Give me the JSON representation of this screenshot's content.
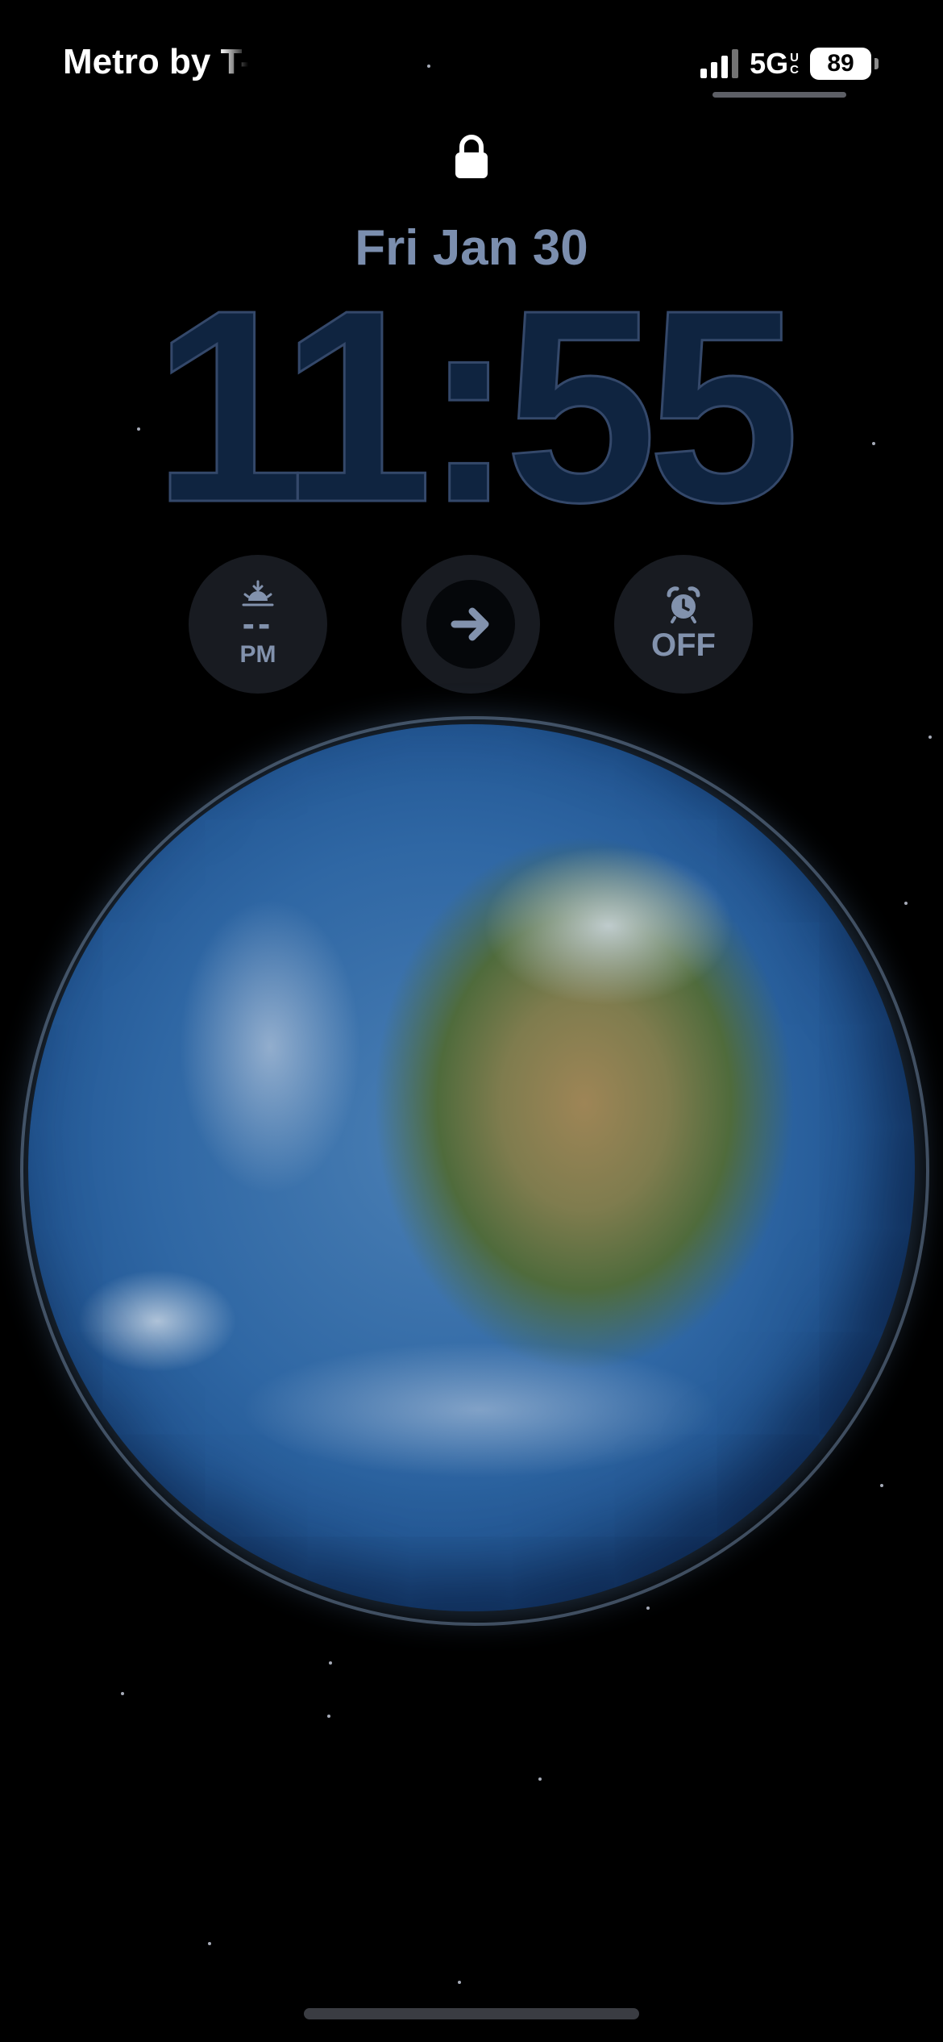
{
  "status_bar": {
    "carrier": "Metro by T-Mobile",
    "network": "5G",
    "network_superscript": [
      "U",
      "C"
    ],
    "battery_level": "89",
    "signal_icon": "signal-bars-icon",
    "battery_icon": "battery-icon"
  },
  "lock_screen": {
    "lock_icon": "lock-icon",
    "date": "Fri Jan 30",
    "time": "11:55"
  },
  "widgets": {
    "sunset": {
      "icon": "sunset-icon",
      "value": "--",
      "period": "PM"
    },
    "shortcut": {
      "icon": "arrow-right-icon"
    },
    "alarm": {
      "icon": "alarm-clock-icon",
      "status": "OFF"
    }
  },
  "wallpaper": {
    "subject": "earth-globe",
    "colors": {
      "background": "#000000",
      "widget_bg": "#181b21",
      "widget_text": "#8292ad",
      "date_text": "#7b8eae",
      "time_text": "#0f2440"
    }
  }
}
